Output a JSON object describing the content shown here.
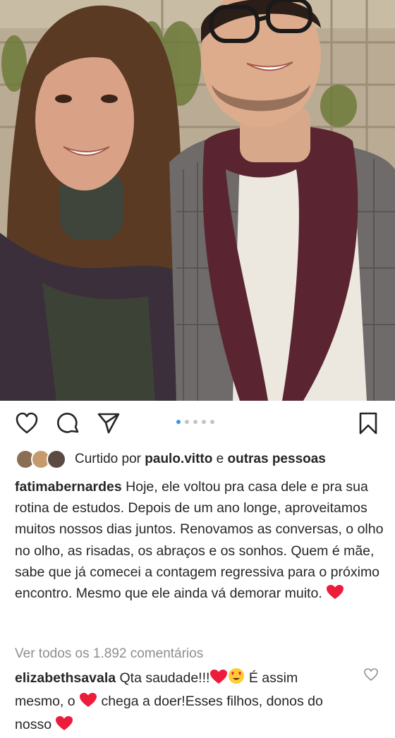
{
  "post": {
    "photo_label": "post-photo",
    "carousel": {
      "count": 5,
      "active_index": 0
    },
    "liked_by": {
      "prefix": "Curtido por",
      "user": "paulo.vitto",
      "joiner": "e",
      "others": "outras pessoas"
    },
    "caption": {
      "username": "fatimabernardes",
      "text": "Hoje, ele voltou pra casa dele e pra sua rotina de estudos. Depois de um ano longe, aproveitamos muitos nossos dias juntos. Renovamos as conversas, o olho no olho, as risadas, os abraços e os sonhos. Quem é mãe, sabe que já comecei a contagem regressiva para o próximo encontro. Mesmo que ele ainda vá demorar muito."
    },
    "view_comments": "Ver todos os 1.892 comentários",
    "comment": {
      "username": "elizabethsavala",
      "part1": "Qta saudade!!!",
      "part2": "É assim mesmo, o",
      "part3": "chega a doer!Esses filhos, donos do nosso"
    }
  },
  "icons": {
    "like": "heart-outline-icon",
    "comment": "comment-bubble-icon",
    "share": "paper-plane-icon",
    "save": "bookmark-icon"
  },
  "colors": {
    "heart": "#ed1c3c",
    "link_dot": "#3897f0",
    "muted": "#8e8e8e"
  }
}
